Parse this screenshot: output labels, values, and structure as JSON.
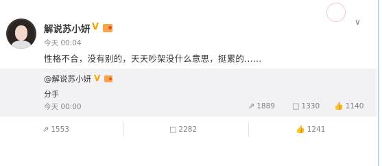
{
  "post": {
    "username": "解说苏小妍",
    "badge_v": "V",
    "time": "今天 00:04",
    "content": "性格不合，没有别的，天天吵架没什么意思，挺累的……"
  },
  "repost": {
    "username": "@解说苏小妍",
    "badge_v": "V",
    "text": "分手",
    "time": "今天 00:00",
    "stats": {
      "share_icon": "share-icon",
      "share_count": "1889",
      "comment_icon": "comment-icon",
      "comment_count": "1330",
      "like_icon": "thumbs-up-icon",
      "like_count": "1140"
    }
  },
  "footer": {
    "share_icon": "share-icon",
    "share_count": "1553",
    "comment_icon": "comment-icon",
    "comment_count": "2282",
    "like_icon": "thumbs-up-icon",
    "like_count": "1241"
  },
  "colors": {
    "vip_orange": "#f7a500",
    "repost_bg": "#f2f2f5",
    "meta_gray": "#808080"
  }
}
